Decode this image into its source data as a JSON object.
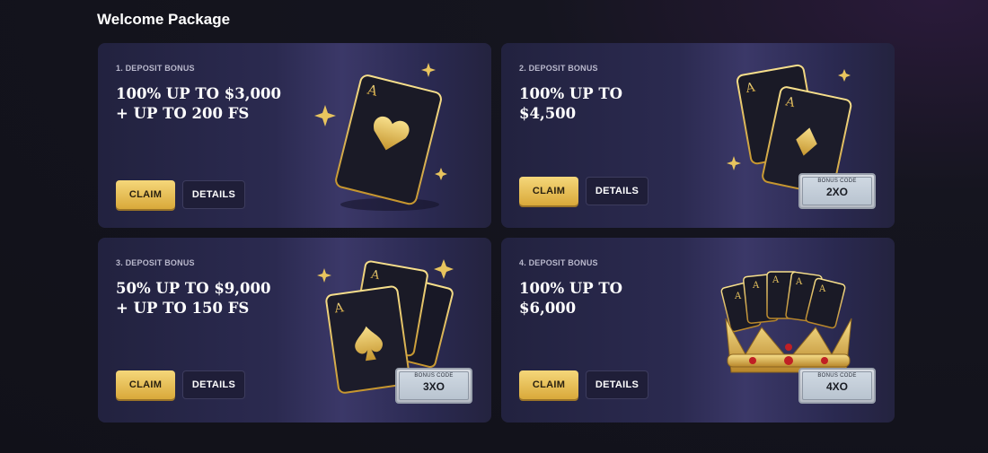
{
  "section": {
    "title": "Welcome Package"
  },
  "cards": [
    {
      "label": "1. Deposit Bonus",
      "headline": "100% UP TO $3,000\n+ UP TO 200 FS",
      "claim": "CLAIM",
      "details": "DETAILS"
    },
    {
      "label": "2. Deposit Bonus",
      "headline": "100% UP TO\n$4,500",
      "claim": "CLAIM",
      "details": "DETAILS",
      "code_label": "BONUS CODE",
      "code": "2XO"
    },
    {
      "label": "3. Deposit Bonus",
      "headline": "50% UP TO $9,000\n+ UP TO 150 FS",
      "claim": "CLAIM",
      "details": "DETAILS",
      "code_label": "BONUS CODE",
      "code": "3XO"
    },
    {
      "label": "4. Deposit Bonus",
      "headline": "100% UP TO\n$6,000",
      "claim": "CLAIM",
      "details": "DETAILS",
      "code_label": "BONUS CODE",
      "code": "4XO"
    }
  ],
  "icons": [
    "ace-of-hearts-card-icon",
    "ace-of-diamonds-cards-icon",
    "ace-of-spades-cards-icon",
    "crown-with-aces-icon",
    "sparkle-icon"
  ],
  "colors": {
    "gold": "#e7c25a",
    "card_bg": "#2b2a50",
    "page_bg": "#111119"
  }
}
